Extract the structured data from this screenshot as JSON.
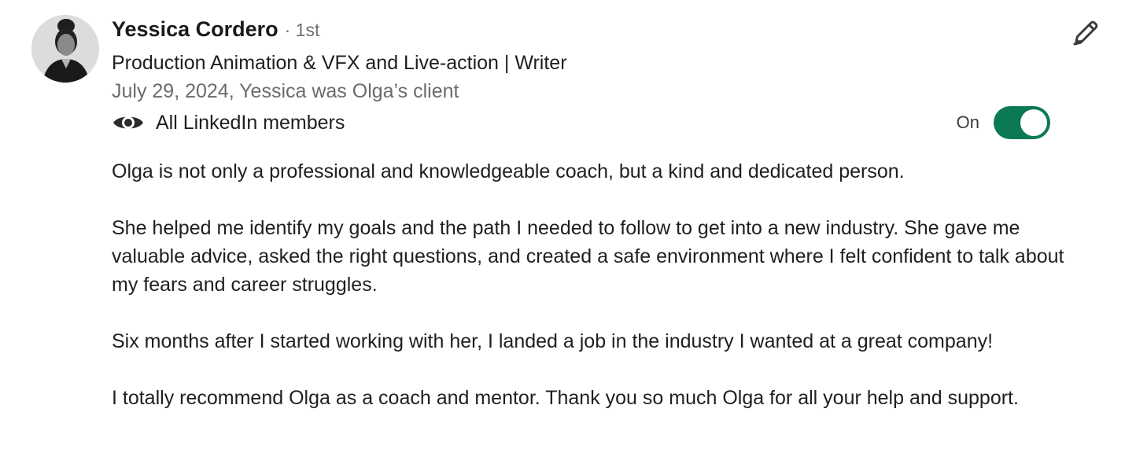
{
  "recommender": {
    "name": "Yessica Cordero",
    "degree": "· 1st",
    "headline": "Production Animation & VFX and Live-action | Writer",
    "meta": "July 29, 2024, Yessica was Olga’s client",
    "avatar_icon": "profile-photo"
  },
  "visibility": {
    "icon": "eye-icon",
    "label": "All LinkedIn members",
    "toggle_label": "On",
    "toggle_state": "on",
    "toggle_color": "#0b7a53"
  },
  "actions": {
    "edit_icon": "pencil-icon"
  },
  "recommendation": {
    "paragraphs": [
      "Olga is not only a professional and knowledgeable coach, but a kind and dedicated person.",
      "She helped me identify my goals and the path I needed to follow to get into a new industry. She gave me valuable advice, asked the right questions, and created a safe environment where I felt confident to talk about my fears and career struggles.",
      "Six months after I started working with her, I landed a job in the industry I wanted at a great company!",
      "I totally recommend Olga as a coach and mentor. Thank you so much Olga for all your help and support."
    ]
  }
}
